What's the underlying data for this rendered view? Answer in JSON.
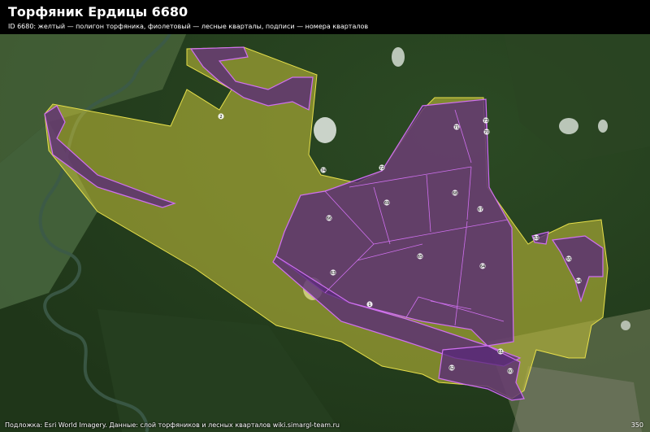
{
  "map": {
    "title": "Торфяник Ердицы 6680",
    "subtitle": "ID 6680: желтый — полигон торфяника, фиолетовый — лесные кварталы, подписи — номера кварталов",
    "attribution": "Подложка: Esri World Imagery. Данные: слой торфяников и лесных кварталов wiki.simargl-team.ru",
    "scale_label": "350",
    "colors": {
      "peat_fill": "#c9c23a",
      "peat_stroke": "#e8e04a",
      "quarter_fill": "#5a2a78",
      "quarter_stroke": "#d070f0",
      "label_bg": "#ffffff"
    },
    "quarter_labels": [
      "2",
      "1",
      "72",
      "73",
      "71",
      "70",
      "74",
      "69",
      "68",
      "67",
      "66",
      "65",
      "64",
      "63",
      "62",
      "61",
      "60",
      "55",
      "54",
      "53"
    ]
  }
}
